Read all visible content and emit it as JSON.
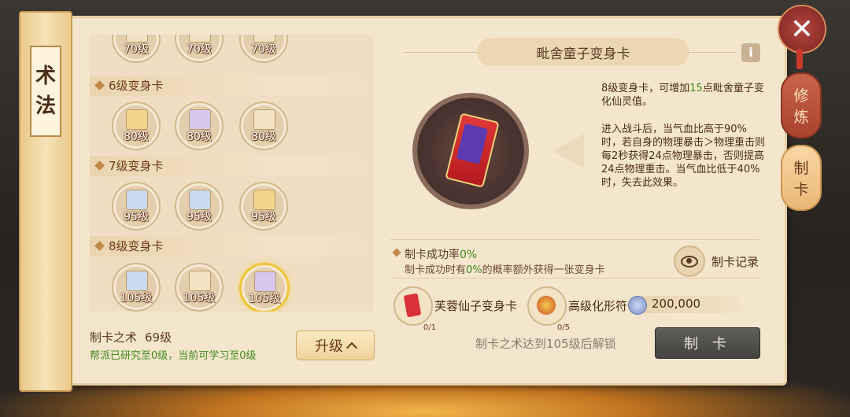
{
  "nav": {
    "title_chars": [
      "术",
      "法"
    ],
    "close_label": "✕",
    "tabs": [
      {
        "chars": [
          "修",
          "炼"
        ],
        "active": false
      },
      {
        "chars": [
          "制",
          "卡"
        ],
        "active": true
      }
    ]
  },
  "card_list": {
    "top_row": [
      {
        "level": "70级",
        "icon": "card-icon"
      },
      {
        "level": "70级",
        "icon": "card-icon"
      },
      {
        "level": "70级",
        "icon": "card-icon"
      }
    ],
    "groups": [
      {
        "title": "6级变身卡",
        "cards": [
          {
            "level": "80级",
            "icon": "card-icon"
          },
          {
            "level": "80级",
            "icon": "card-icon"
          },
          {
            "level": "80级",
            "icon": "card-icon"
          }
        ]
      },
      {
        "title": "7级变身卡",
        "cards": [
          {
            "level": "95级",
            "icon": "card-icon"
          },
          {
            "level": "95级",
            "icon": "card-icon"
          },
          {
            "level": "95级",
            "icon": "card-icon"
          }
        ]
      },
      {
        "title": "8级变身卡",
        "cards": [
          {
            "level": "105级",
            "icon": "card-icon"
          },
          {
            "level": "105级",
            "icon": "card-icon"
          },
          {
            "level": "105级",
            "icon": "card-icon",
            "selected": true
          }
        ]
      }
    ]
  },
  "skill": {
    "name": "制卡之术",
    "level": "69级",
    "research_note": "帮派已研究至0级，当前可学习至0级",
    "upgrade_label": "升级"
  },
  "detail": {
    "title": "毗舍童子变身卡",
    "info_icon": "i",
    "desc_line1_pre": "8级变身卡，可增加",
    "desc_line1_num": "15",
    "desc_line1_post": "点毗舍童子变化仙灵值。",
    "desc_para2": "进入战斗后，当气血比高于90%时，若自身的物理暴击＞物理重击则每2秒获得24点物理暴击，否则提高24点物理重击。当气血比低于40%时，失去此效果。",
    "success_label": "制卡成功率",
    "success_rate": "0%",
    "success_sub_pre": "制卡成功时有",
    "success_sub_rate": "0%",
    "success_sub_post": "的概率额外获得一张变身卡",
    "record_label": "制卡记录",
    "materials": [
      {
        "name": "芙蓉仙子变身卡",
        "count": "0/1"
      },
      {
        "name": "高级化形符",
        "count": "0/5"
      }
    ],
    "cost": "200,000",
    "unlock_text": "制卡之术达到105级后解锁",
    "make_label": "制 卡"
  },
  "colors": {
    "highlight_green": "#3f8a1e",
    "panel_bg": "#f4e6cd",
    "selected_border": "#f0c43a"
  }
}
